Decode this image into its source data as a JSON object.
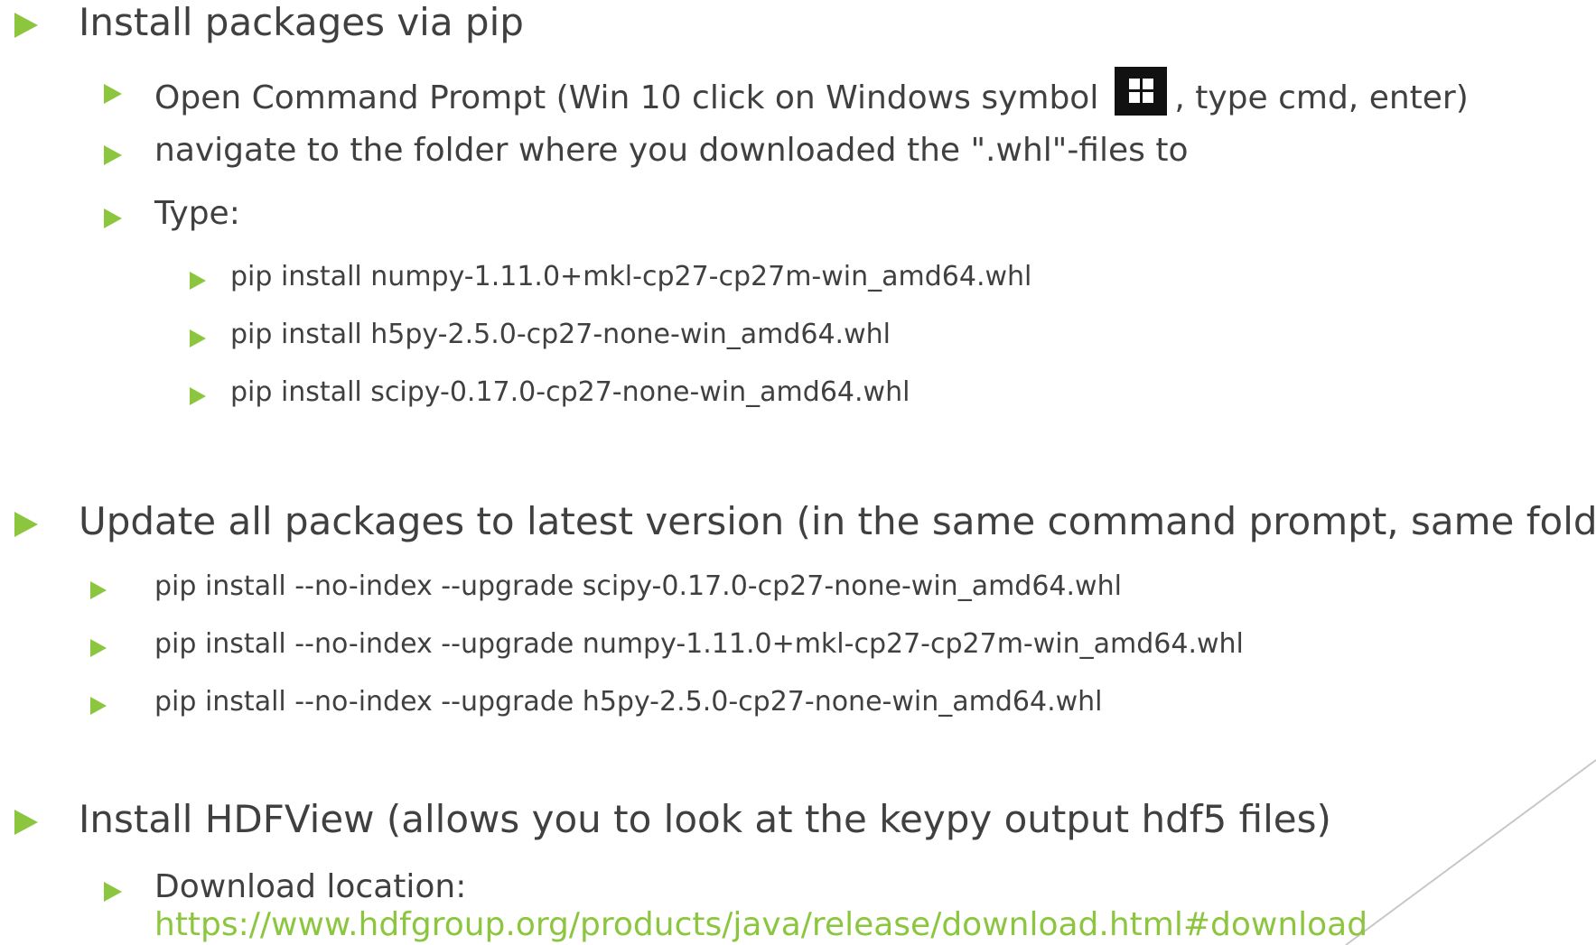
{
  "sections": [
    {
      "heading": "Install packages via pip",
      "open_prompt_before": "Open Command Prompt (Win 10 click on Windows symbol",
      "open_prompt_after": ", type cmd, enter)",
      "navigate": "navigate to the folder where you downloaded the \".whl\"-files to",
      "type_label": "Type:",
      "commands": [
        "pip install numpy-1.11.0+mkl-cp27-cp27m-win_amd64.whl",
        "pip install h5py-2.5.0-cp27-none-win_amd64.whl",
        "pip install scipy-0.17.0-cp27-none-win_amd64.whl"
      ]
    },
    {
      "heading": "Update all packages to latest version (in the same command prompt, same folder)",
      "commands": [
        "pip install --no-index --upgrade scipy-0.17.0-cp27-none-win_amd64.whl",
        "pip install --no-index --upgrade numpy-1.11.0+mkl-cp27-cp27m-win_amd64.whl",
        "pip install --no-index --upgrade h5py-2.5.0-cp27-none-win_amd64.whl"
      ]
    },
    {
      "heading": "Install HDFView (allows you to look at the keypy output hdf5 files)",
      "download_label": "Download location:",
      "download_url": "https://www.hdfgroup.org/products/java/release/download.html#download"
    }
  ],
  "icons": {
    "bullet": "triangle-bullet-icon",
    "windows": "windows-logo-icon"
  },
  "colors": {
    "bullet": "#8cc63f",
    "link": "#8cc63f",
    "text": "#404040"
  }
}
